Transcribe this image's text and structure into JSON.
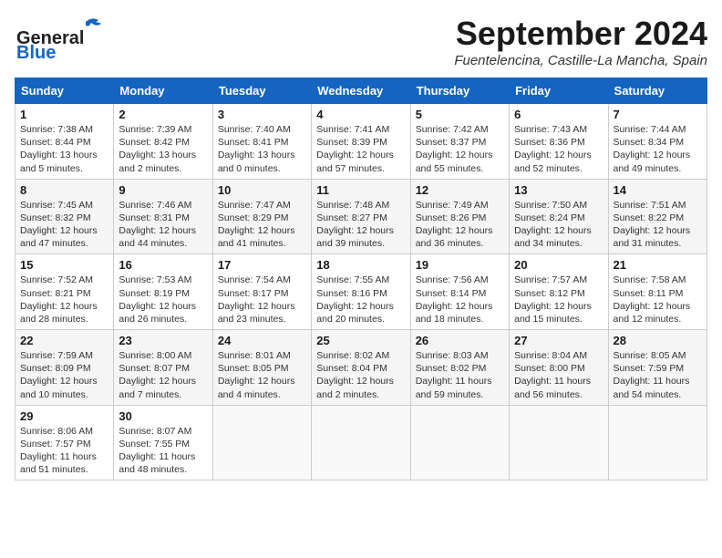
{
  "header": {
    "logo_general": "General",
    "logo_blue": "Blue",
    "month_title": "September 2024",
    "subtitle": "Fuentelencina, Castille-La Mancha, Spain"
  },
  "weekdays": [
    "Sunday",
    "Monday",
    "Tuesday",
    "Wednesday",
    "Thursday",
    "Friday",
    "Saturday"
  ],
  "weeks": [
    [
      {
        "day": "1",
        "sunrise": "7:38 AM",
        "sunset": "8:44 PM",
        "daylight": "13 hours and 5 minutes."
      },
      {
        "day": "2",
        "sunrise": "7:39 AM",
        "sunset": "8:42 PM",
        "daylight": "13 hours and 2 minutes."
      },
      {
        "day": "3",
        "sunrise": "7:40 AM",
        "sunset": "8:41 PM",
        "daylight": "13 hours and 0 minutes."
      },
      {
        "day": "4",
        "sunrise": "7:41 AM",
        "sunset": "8:39 PM",
        "daylight": "12 hours and 57 minutes."
      },
      {
        "day": "5",
        "sunrise": "7:42 AM",
        "sunset": "8:37 PM",
        "daylight": "12 hours and 55 minutes."
      },
      {
        "day": "6",
        "sunrise": "7:43 AM",
        "sunset": "8:36 PM",
        "daylight": "12 hours and 52 minutes."
      },
      {
        "day": "7",
        "sunrise": "7:44 AM",
        "sunset": "8:34 PM",
        "daylight": "12 hours and 49 minutes."
      }
    ],
    [
      {
        "day": "8",
        "sunrise": "7:45 AM",
        "sunset": "8:32 PM",
        "daylight": "12 hours and 47 minutes."
      },
      {
        "day": "9",
        "sunrise": "7:46 AM",
        "sunset": "8:31 PM",
        "daylight": "12 hours and 44 minutes."
      },
      {
        "day": "10",
        "sunrise": "7:47 AM",
        "sunset": "8:29 PM",
        "daylight": "12 hours and 41 minutes."
      },
      {
        "day": "11",
        "sunrise": "7:48 AM",
        "sunset": "8:27 PM",
        "daylight": "12 hours and 39 minutes."
      },
      {
        "day": "12",
        "sunrise": "7:49 AM",
        "sunset": "8:26 PM",
        "daylight": "12 hours and 36 minutes."
      },
      {
        "day": "13",
        "sunrise": "7:50 AM",
        "sunset": "8:24 PM",
        "daylight": "12 hours and 34 minutes."
      },
      {
        "day": "14",
        "sunrise": "7:51 AM",
        "sunset": "8:22 PM",
        "daylight": "12 hours and 31 minutes."
      }
    ],
    [
      {
        "day": "15",
        "sunrise": "7:52 AM",
        "sunset": "8:21 PM",
        "daylight": "12 hours and 28 minutes."
      },
      {
        "day": "16",
        "sunrise": "7:53 AM",
        "sunset": "8:19 PM",
        "daylight": "12 hours and 26 minutes."
      },
      {
        "day": "17",
        "sunrise": "7:54 AM",
        "sunset": "8:17 PM",
        "daylight": "12 hours and 23 minutes."
      },
      {
        "day": "18",
        "sunrise": "7:55 AM",
        "sunset": "8:16 PM",
        "daylight": "12 hours and 20 minutes."
      },
      {
        "day": "19",
        "sunrise": "7:56 AM",
        "sunset": "8:14 PM",
        "daylight": "12 hours and 18 minutes."
      },
      {
        "day": "20",
        "sunrise": "7:57 AM",
        "sunset": "8:12 PM",
        "daylight": "12 hours and 15 minutes."
      },
      {
        "day": "21",
        "sunrise": "7:58 AM",
        "sunset": "8:11 PM",
        "daylight": "12 hours and 12 minutes."
      }
    ],
    [
      {
        "day": "22",
        "sunrise": "7:59 AM",
        "sunset": "8:09 PM",
        "daylight": "12 hours and 10 minutes."
      },
      {
        "day": "23",
        "sunrise": "8:00 AM",
        "sunset": "8:07 PM",
        "daylight": "12 hours and 7 minutes."
      },
      {
        "day": "24",
        "sunrise": "8:01 AM",
        "sunset": "8:05 PM",
        "daylight": "12 hours and 4 minutes."
      },
      {
        "day": "25",
        "sunrise": "8:02 AM",
        "sunset": "8:04 PM",
        "daylight": "12 hours and 2 minutes."
      },
      {
        "day": "26",
        "sunrise": "8:03 AM",
        "sunset": "8:02 PM",
        "daylight": "11 hours and 59 minutes."
      },
      {
        "day": "27",
        "sunrise": "8:04 AM",
        "sunset": "8:00 PM",
        "daylight": "11 hours and 56 minutes."
      },
      {
        "day": "28",
        "sunrise": "8:05 AM",
        "sunset": "7:59 PM",
        "daylight": "11 hours and 54 minutes."
      }
    ],
    [
      {
        "day": "29",
        "sunrise": "8:06 AM",
        "sunset": "7:57 PM",
        "daylight": "11 hours and 51 minutes."
      },
      {
        "day": "30",
        "sunrise": "8:07 AM",
        "sunset": "7:55 PM",
        "daylight": "11 hours and 48 minutes."
      },
      null,
      null,
      null,
      null,
      null
    ]
  ],
  "labels": {
    "sunrise": "Sunrise:",
    "sunset": "Sunset:",
    "daylight": "Daylight:"
  }
}
